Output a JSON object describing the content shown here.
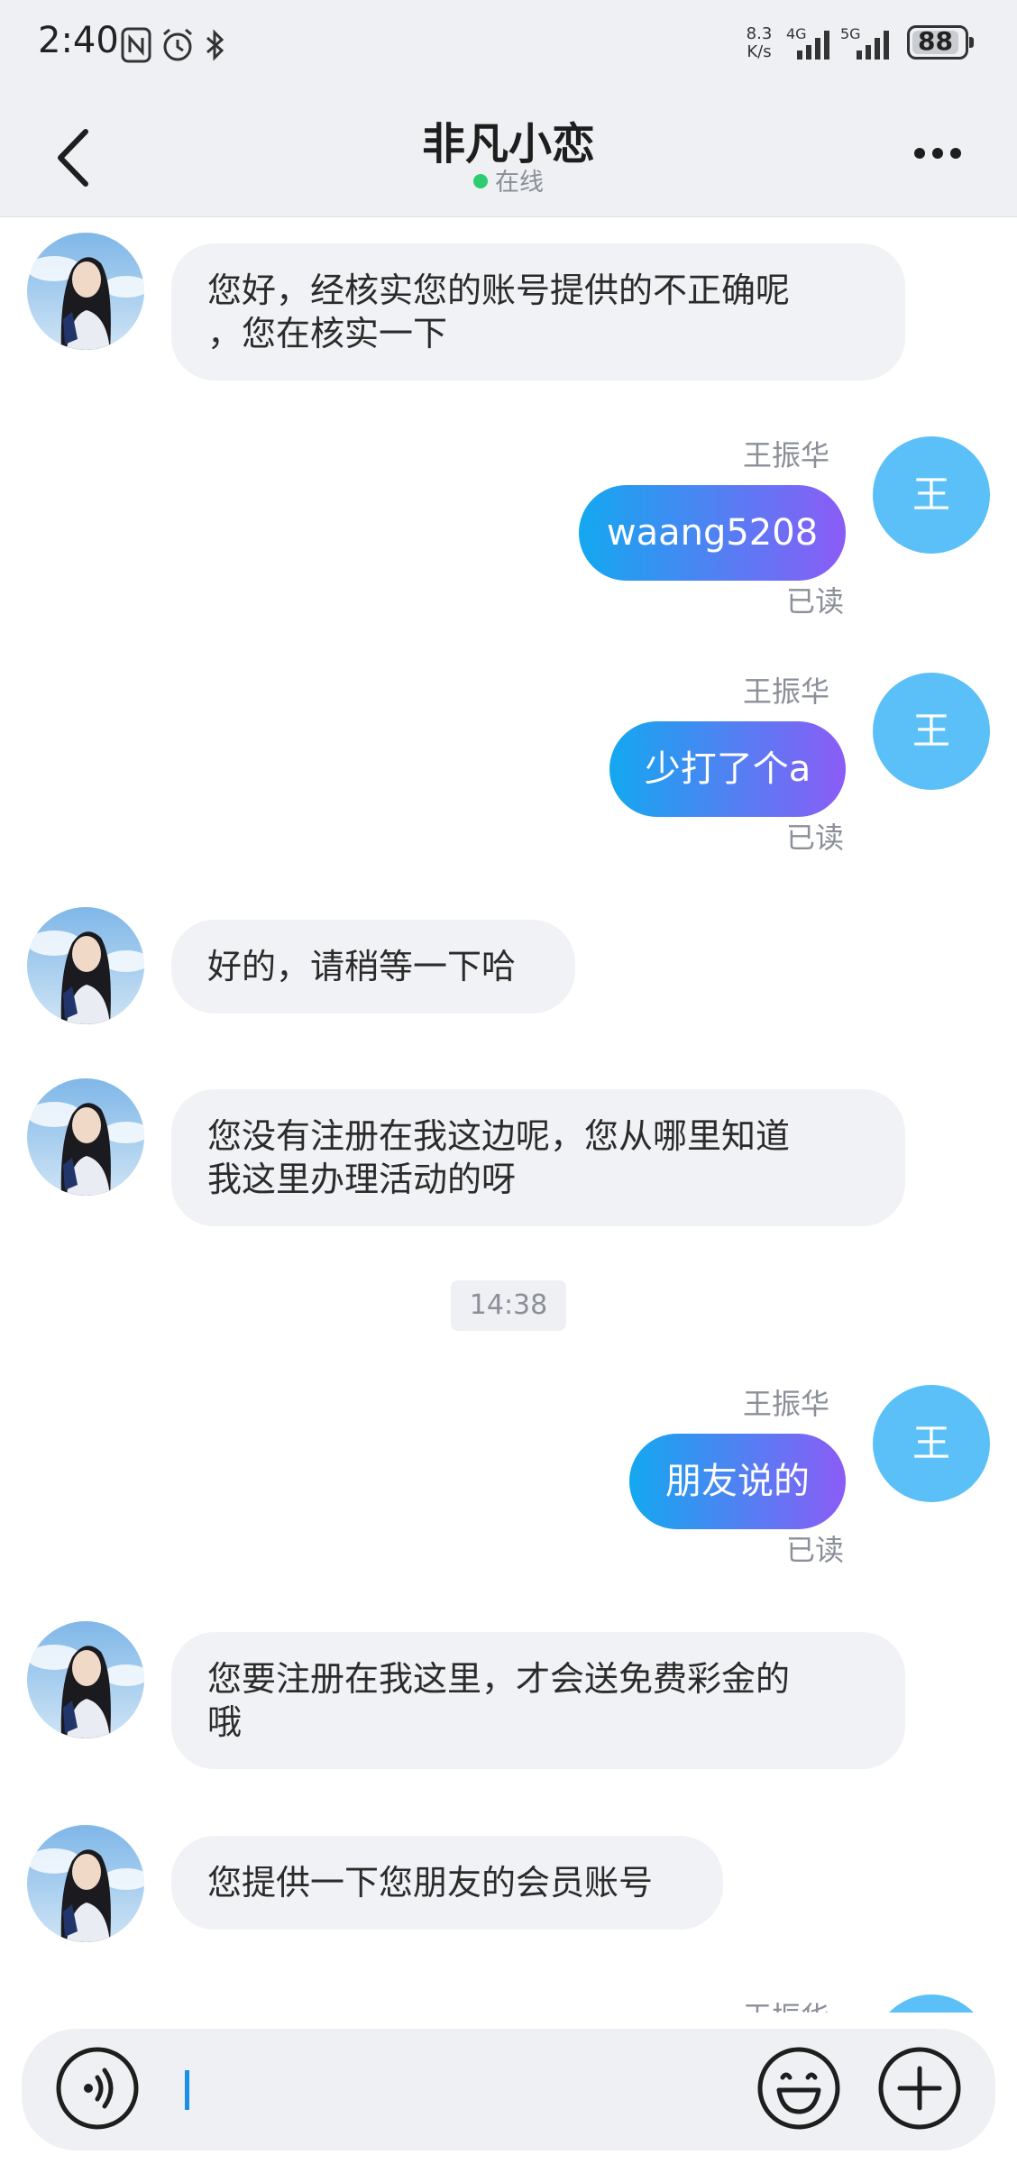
{
  "status_bar": {
    "time": "2:40",
    "net_speed_value": "8.3",
    "net_speed_unit": "K/s",
    "signal_1": "4G",
    "signal_2": "5G",
    "battery": "88"
  },
  "header": {
    "title": "非凡小恋",
    "status": "在线"
  },
  "messages": [
    {
      "side": "left",
      "text_lines": [
        "您好，经核实您的账号提供的不正确呢",
        "，您在核实一下"
      ]
    },
    {
      "side": "right",
      "sender": "王振华",
      "avatar_char": "王",
      "text": "waang5208",
      "receipt": "已读"
    },
    {
      "side": "right",
      "sender": "王振华",
      "avatar_char": "王",
      "text": "少打了个a",
      "receipt": "已读"
    },
    {
      "side": "left",
      "text_lines": [
        "好的，请稍等一下哈"
      ]
    },
    {
      "side": "left",
      "text_lines": [
        "您没有注册在我这边呢，您从哪里知道",
        "我这里办理活动的呀"
      ]
    },
    {
      "side": "time",
      "text": "14:38"
    },
    {
      "side": "right",
      "sender": "王振华",
      "avatar_char": "王",
      "text": "朋友说的",
      "receipt": "已读"
    },
    {
      "side": "left",
      "text_lines": [
        "您要注册在我这里，才会送免费彩金的",
        "哦"
      ]
    },
    {
      "side": "left",
      "text_lines": [
        "您提供一下您朋友的会员账号"
      ]
    },
    {
      "side": "right",
      "sender": "王振华",
      "partial": true
    }
  ],
  "colors": {
    "accent_gradient_start": "#13a8ef",
    "accent_gradient_end": "#8b5cf6",
    "avatar_right": "#5bc0f7",
    "online_dot": "#2ecc71"
  },
  "icons": [
    "back-icon",
    "more-icon",
    "voice-icon",
    "emoji-icon",
    "plus-icon",
    "nfc-icon",
    "alarm-icon",
    "bluetooth-icon"
  ]
}
